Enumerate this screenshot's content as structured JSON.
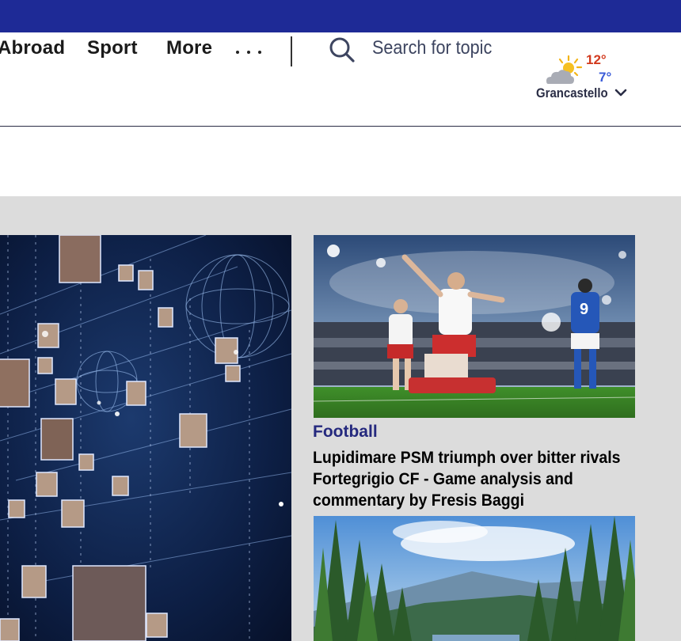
{
  "nav": {
    "items": [
      {
        "label": "Abroad"
      },
      {
        "label": "Sport"
      },
      {
        "label": "More"
      }
    ],
    "more_dots_icon": "ellipsis-icon"
  },
  "search": {
    "icon": "search-icon",
    "placeholder": "Search for topic"
  },
  "weather": {
    "icon": "partly-cloudy-icon",
    "high": "12°",
    "low": "7°",
    "location": "Grancastello",
    "dropdown_icon": "chevron-down-icon"
  },
  "colors": {
    "topbar": "#1e2a96",
    "category": "#25297e",
    "temp_high": "#d23a1e",
    "temp_low": "#3a5bd8"
  },
  "articles": {
    "main": {
      "image": "network-faces-image"
    },
    "football": {
      "image": "football-celebration-image",
      "category": "Football",
      "headline": "Lupidimare PSM triumph over bitter rivals Fortegrigio CF - Game analysis and commentary by Fresis Baggi"
    },
    "forest": {
      "image": "forest-landscape-image"
    }
  }
}
